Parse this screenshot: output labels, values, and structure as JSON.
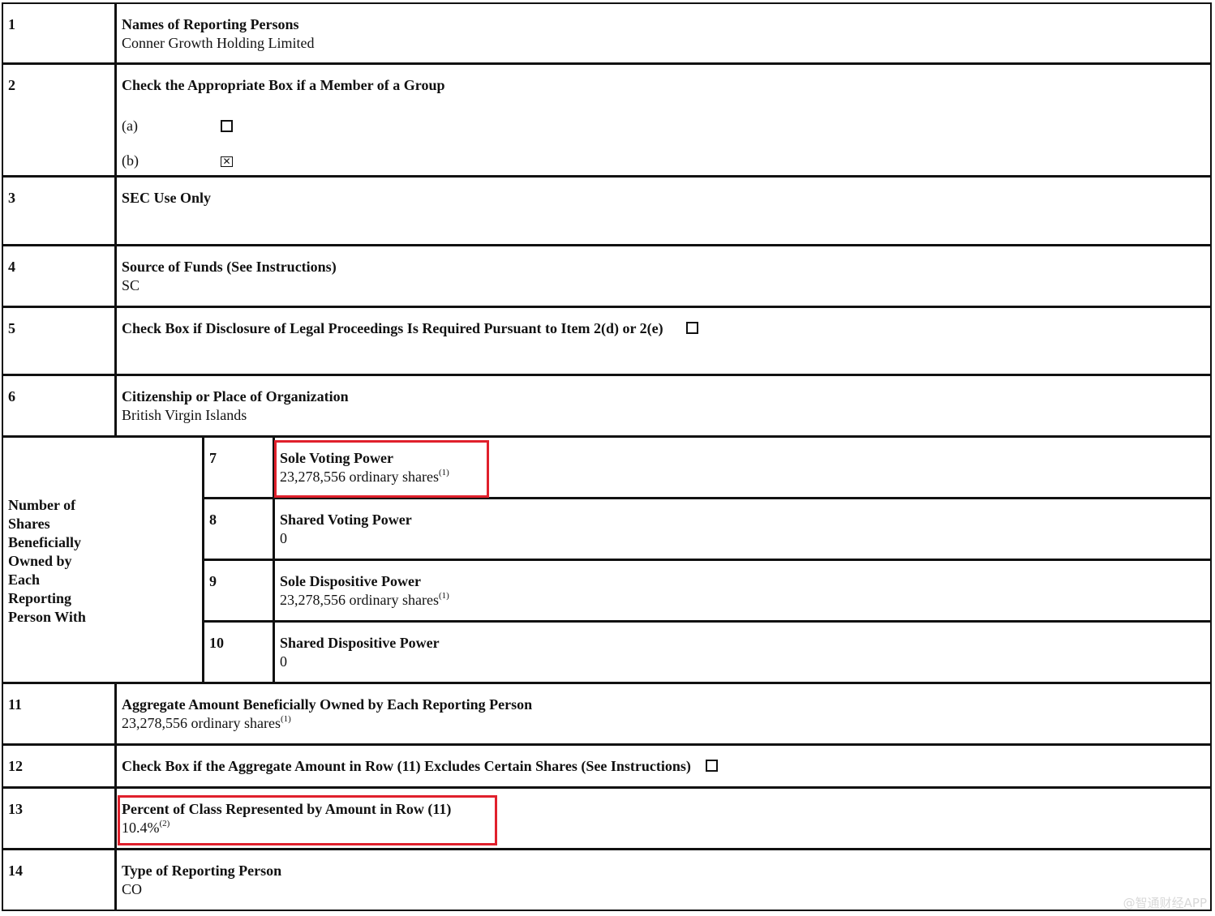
{
  "rows": [
    {
      "num": "1",
      "label": "Names of Reporting Persons",
      "value": "Conner Growth Holding Limited"
    },
    {
      "num": "2",
      "label": "Check the Appropriate Box if a Member of a Group",
      "options": [
        {
          "label": "(a)",
          "checked": false
        },
        {
          "label": "(b)",
          "checked": true
        }
      ]
    },
    {
      "num": "3",
      "label": "SEC Use Only"
    },
    {
      "num": "4",
      "label": "Source of Funds (See Instructions)",
      "value": "SC"
    },
    {
      "num": "5",
      "label": "Check Box if Disclosure of Legal Proceedings Is Required Pursuant to Item 2(d) or 2(e)",
      "checked": false
    },
    {
      "num": "6",
      "label": "Citizenship or Place of Organization",
      "value": "British Virgin Islands"
    },
    {
      "num": "7",
      "label": "Sole Voting Power",
      "value": "23,278,556 ordinary shares",
      "note": "(1)"
    },
    {
      "num": "8",
      "label": "Shared Voting Power",
      "value": "0"
    },
    {
      "num": "9",
      "label": "Sole Dispositive Power",
      "value": "23,278,556 ordinary shares",
      "note": "(1)"
    },
    {
      "num": "10",
      "label": "Shared Dispositive Power",
      "value": "0"
    },
    {
      "num": "11",
      "label": "Aggregate Amount Beneficially Owned by Each Reporting Person",
      "value": "23,278,556 ordinary shares",
      "note": "(1)"
    },
    {
      "num": "12",
      "label": "Check Box if the Aggregate Amount in Row (11) Excludes Certain Shares (See Instructions)",
      "checked": false
    },
    {
      "num": "13",
      "label": "Percent of Class Represented by Amount in Row (11)",
      "value": "10.4%",
      "note": "(2)"
    },
    {
      "num": "14",
      "label": "Type of Reporting Person",
      "value": "CO"
    }
  ],
  "group_label_lines": [
    "Number of",
    "Shares",
    "Beneficially",
    "Owned by",
    "Each",
    "Reporting",
    "Person With"
  ],
  "checkbox_mark": "☒",
  "watermark": "@智通财经APP",
  "highlight_color": "#e0202c"
}
